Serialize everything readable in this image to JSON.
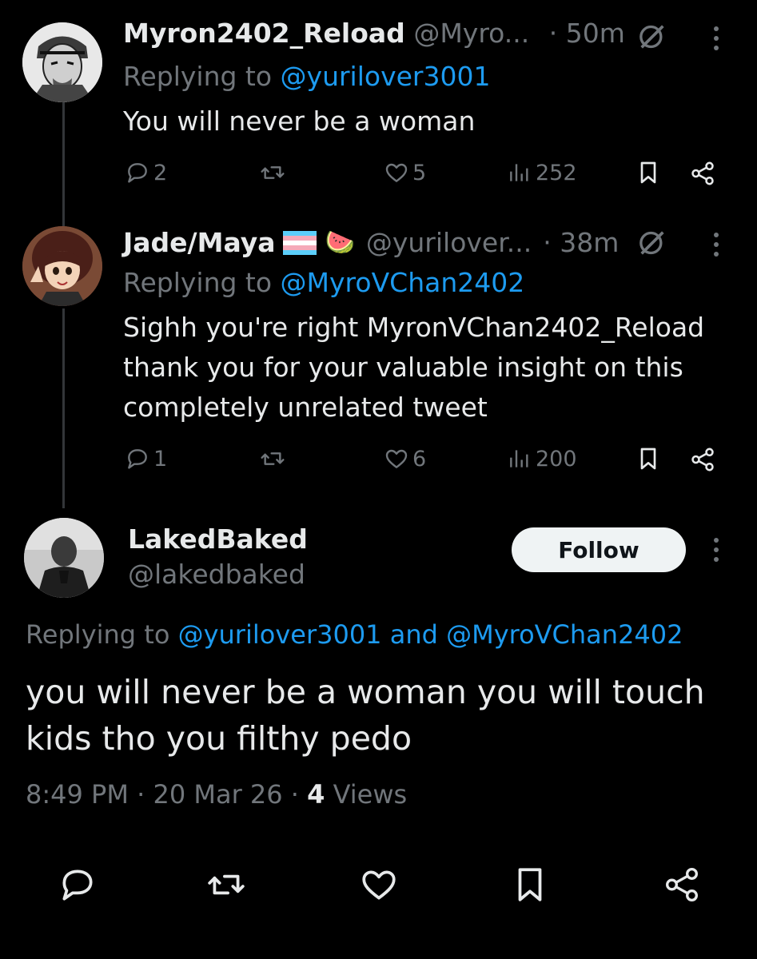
{
  "tweets": [
    {
      "display_name": "Myron2402_Reload",
      "handle": "@Myro...",
      "time": "· 50m",
      "replying_prefix": "Replying to",
      "replying_to": "@yurilover3001",
      "text": "You will never be a woman",
      "replies": "2",
      "likes": "5",
      "views": "252"
    },
    {
      "display_name": "Jade/Maya",
      "name_emojis": "🍉",
      "handle": "@yurilover...",
      "time": "· 38m",
      "replying_prefix": "Replying to",
      "replying_to": "@MyroVChan2402",
      "text_lines": [
        "Sighh you're right MyronVChan2402_Reload",
        "thank you for your valuable insight on this",
        "completely unrelated tweet"
      ],
      "replies": "1",
      "likes": "6",
      "views": "200"
    }
  ],
  "focused": {
    "display_name": "LakedBaked",
    "handle": "@lakedbaked",
    "follow_label": "Follow",
    "replying_prefix": "Replying to",
    "replying_to_1": "@yurilover3001",
    "replying_and": "and",
    "replying_to_2": "@MyroVChan2402",
    "text_lines": [
      "you will never be a woman you will touch",
      "kids tho you filthy pedo"
    ],
    "time": "8:49 PM",
    "sep": "·",
    "date": "20 Mar 26",
    "views_count": "4",
    "views_label": "Views"
  },
  "colors": {
    "background": "#000000",
    "text": "#e7e9ea",
    "muted": "#71767b",
    "link": "#1d9bf0",
    "follow_bg": "#eff3f4"
  },
  "icons": [
    "grok-icon",
    "more-icon",
    "reply-icon",
    "retweet-icon",
    "like-icon",
    "views-icon",
    "bookmark-icon",
    "share-icon",
    "trans-flag-icon"
  ]
}
